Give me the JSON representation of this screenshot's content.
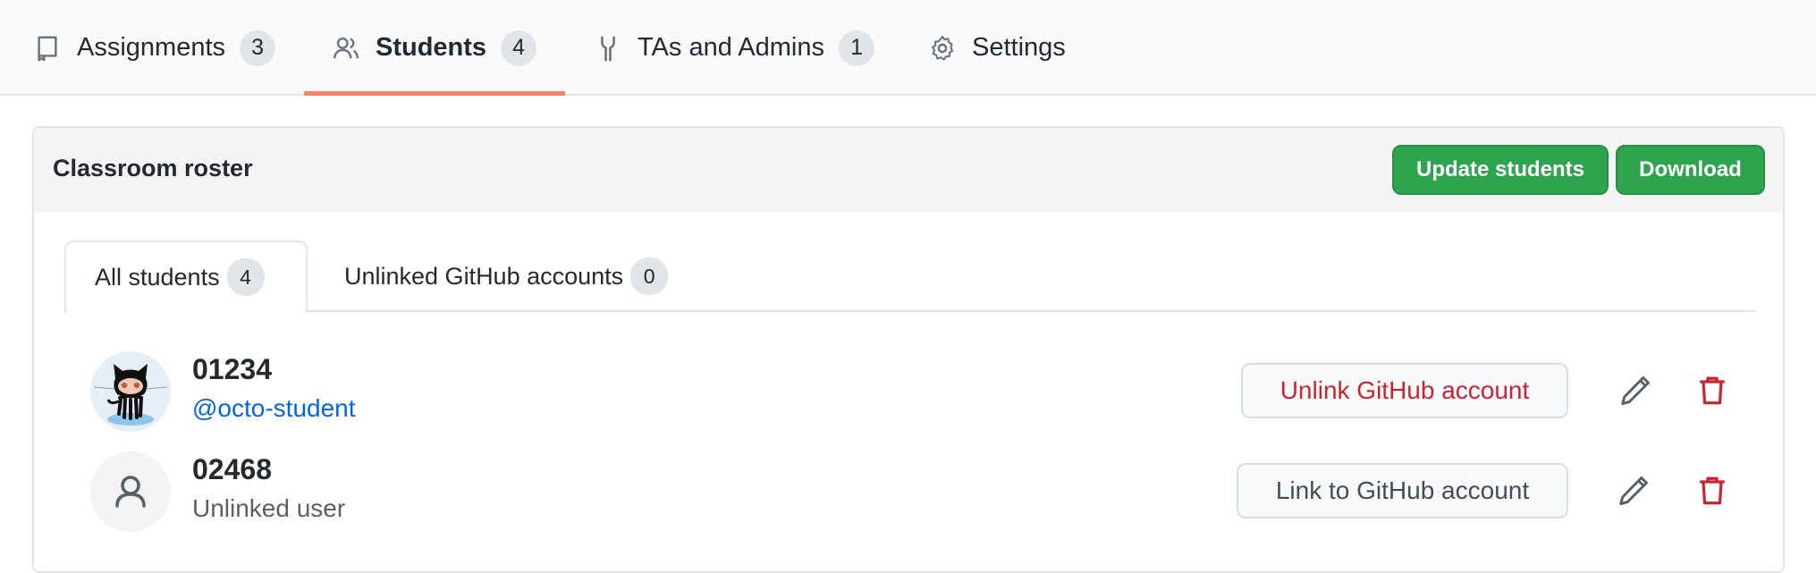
{
  "nav": {
    "tabs": [
      {
        "label": "Assignments",
        "count": "3",
        "icon": "book-icon",
        "active": false
      },
      {
        "label": "Students",
        "count": "4",
        "icon": "people-icon",
        "active": true
      },
      {
        "label": "TAs and Admins",
        "count": "1",
        "icon": "tools-icon",
        "active": false
      },
      {
        "label": "Settings",
        "icon": "gear-icon",
        "active": false
      }
    ]
  },
  "roster": {
    "title": "Classroom roster",
    "update_label": "Update students",
    "download_label": "Download",
    "tabs": [
      {
        "label": "All students",
        "count": "4",
        "active": true
      },
      {
        "label": "Unlinked GitHub accounts",
        "count": "0",
        "active": false
      }
    ],
    "students": [
      {
        "id": "01234",
        "sub": "@octo-student",
        "linked": true,
        "action_label": "Unlink GitHub account",
        "avatar": "octocat-avatar"
      },
      {
        "id": "02468",
        "sub": "Unlinked user",
        "linked": false,
        "action_label": "Link to GitHub account",
        "avatar": "person-icon"
      }
    ]
  },
  "colors": {
    "accent_underline": "#f78166",
    "primary_green": "#2ea44f",
    "danger_red": "#cb2431",
    "link_blue": "#0366d6"
  }
}
